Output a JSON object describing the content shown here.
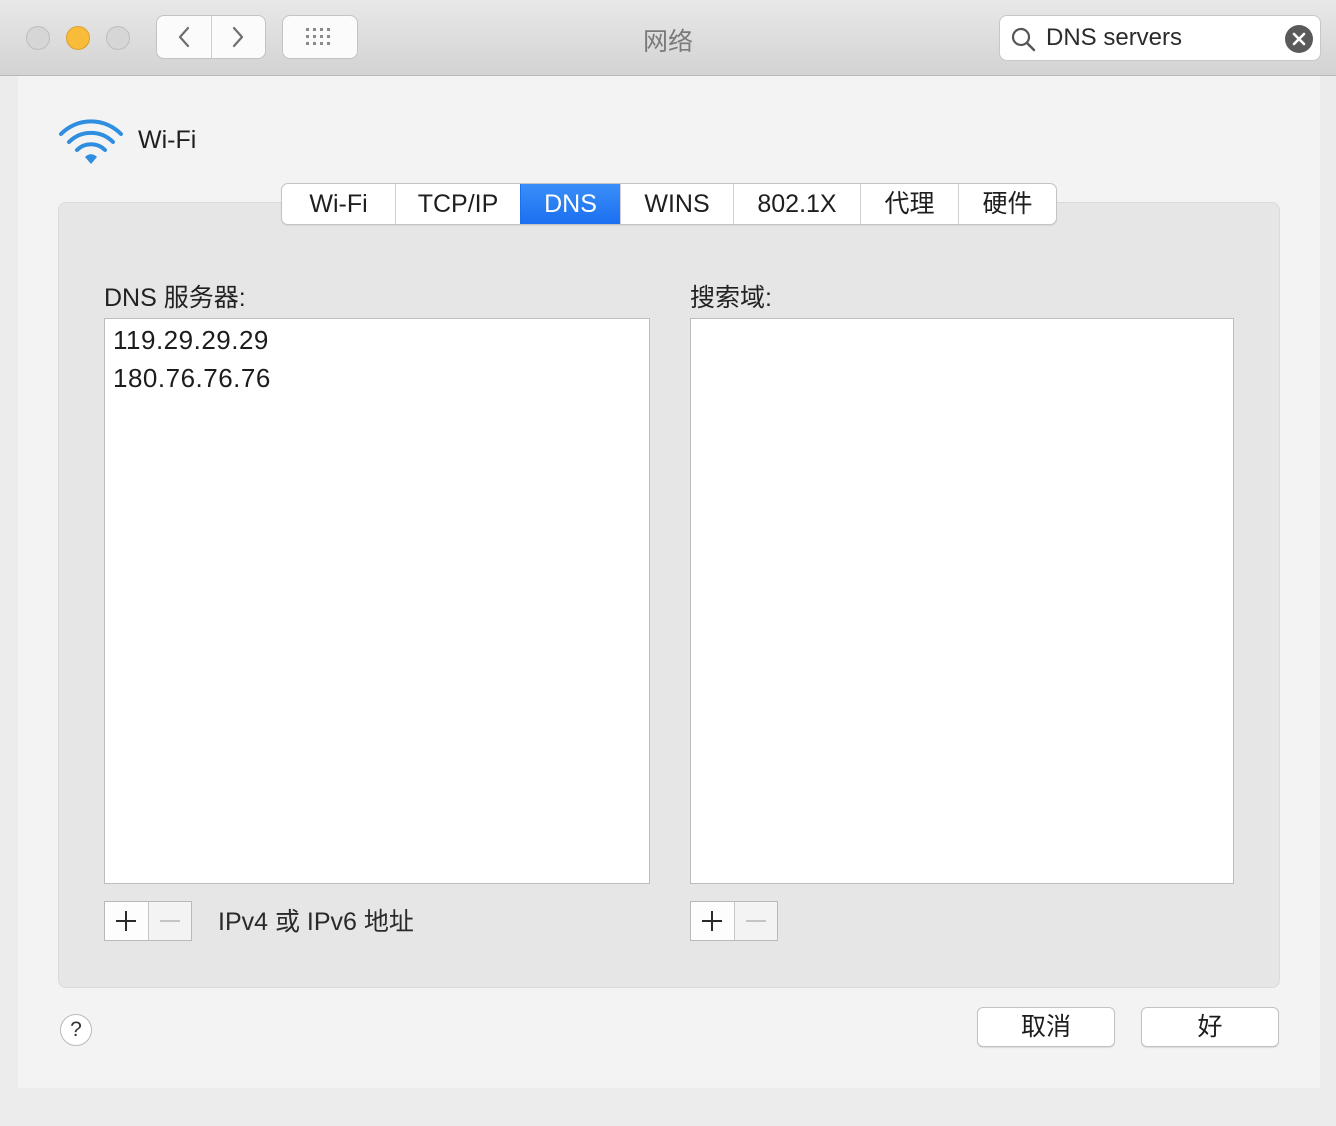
{
  "window": {
    "title": "网络"
  },
  "search": {
    "value": "DNS servers"
  },
  "interface": {
    "name": "Wi-Fi"
  },
  "tabs": [
    {
      "label": "Wi-Fi",
      "active": false
    },
    {
      "label": "TCP/IP",
      "active": false
    },
    {
      "label": "DNS",
      "active": true
    },
    {
      "label": "WINS",
      "active": false
    },
    {
      "label": "802.1X",
      "active": false
    },
    {
      "label": "代理",
      "active": false
    },
    {
      "label": "硬件",
      "active": false
    }
  ],
  "dns_servers": {
    "label": "DNS 服务器:",
    "items": [
      "119.29.29.29",
      "180.76.76.76"
    ],
    "hint": "IPv4 或 IPv6 地址"
  },
  "search_domains": {
    "label": "搜索域:",
    "items": []
  },
  "buttons": {
    "help": "?",
    "cancel": "取消",
    "ok": "好"
  },
  "colors": {
    "accent": "#1c6ff0",
    "minimize": "#f8bb3a",
    "wifi": "#2f8ee0"
  }
}
